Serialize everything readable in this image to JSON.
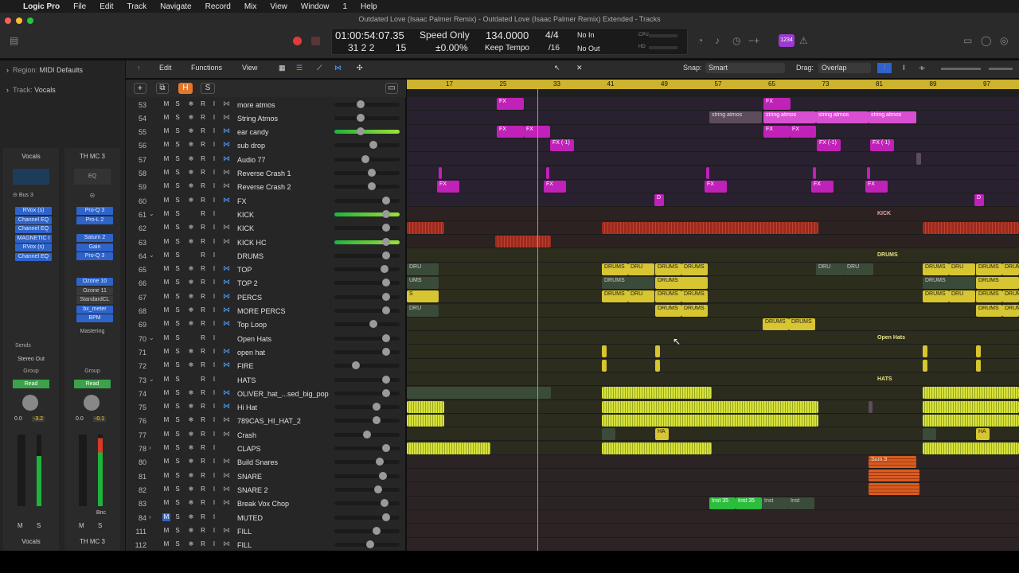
{
  "menu": {
    "apple": "",
    "app": "Logic Pro",
    "items": [
      "File",
      "Edit",
      "Track",
      "Navigate",
      "Record",
      "Mix",
      "View",
      "Window",
      "1",
      "Help"
    ]
  },
  "window": {
    "title": "Outdated Love (Isaac Palmer Remix) - Outdated Love (Isaac Palmer Remix) Extended - Tracks"
  },
  "lcd": {
    "time": "01:00:54:07.35",
    "bars": "31  2  2",
    "ticks": "15",
    "mode": "Speed Only",
    "speed": "±0.00%",
    "tempo": "134.0000",
    "tempo_mode": "Keep Tempo",
    "sig": "4/4",
    "div": "/16",
    "in": "No In",
    "out": "No Out",
    "cpu": "CPU",
    "hd": "HD"
  },
  "toolbar_badge": "1234",
  "inspector": {
    "region": "Region:",
    "region_val": "MIDI Defaults",
    "track": "Track:",
    "track_val": "Vocals"
  },
  "strip1": {
    "name": "Vocals",
    "bus": "Bus 3",
    "plugins": [
      "RVox (s)",
      "Channel EQ",
      "Channel EQ",
      "MAGNETIC I",
      "RVox (s)",
      "Channel EQ"
    ],
    "sends": "Sends",
    "output": "Stereo Out",
    "group": "Group",
    "auto": "Read",
    "pan": "0.0",
    "peak": "-3.2",
    "m": "M",
    "s": "S",
    "label": "Vocals"
  },
  "strip2": {
    "name": "TH MC 3",
    "eq": "EQ",
    "plugins": [
      "Pro-Q 3",
      "Pro-L 2"
    ],
    "plugins2": [
      "Saturn 2",
      "Gain",
      "Pro-Q 3"
    ],
    "plugins3": [
      "Ozone 10",
      "Ozone 11",
      "StandardCL",
      "bx_meter",
      "BPM"
    ],
    "mastering": "Mastering",
    "group": "Group",
    "auto": "Read",
    "pan": "0.0",
    "peak": "-0.1",
    "bnc": "Bnc",
    "m": "M",
    "s": "S",
    "label": "TH MC 3"
  },
  "ctrl": {
    "edit": "Edit",
    "functions": "Functions",
    "view": "View",
    "snap_label": "Snap:",
    "snap": "Smart",
    "drag_label": "Drag:",
    "drag": "Overlap"
  },
  "hdr": {
    "add": "+",
    "h": "H",
    "s": "S"
  },
  "ruler": [
    "17",
    "25",
    "33",
    "41",
    "49",
    "57",
    "65",
    "73",
    "81",
    "89",
    "97"
  ],
  "tracks": [
    {
      "n": "53",
      "name": "more atmos"
    },
    {
      "n": "54",
      "name": "String Atmos"
    },
    {
      "n": "55",
      "name": "ear candy"
    },
    {
      "n": "56",
      "name": "sub drop"
    },
    {
      "n": "57",
      "name": "Audio 77"
    },
    {
      "n": "58",
      "name": "Reverse Crash 1"
    },
    {
      "n": "59",
      "name": "Reverse Crash 2"
    },
    {
      "n": "60",
      "name": "FX"
    },
    {
      "n": "61",
      "name": "KICK"
    },
    {
      "n": "62",
      "name": "KICK"
    },
    {
      "n": "63",
      "name": "KICK HC"
    },
    {
      "n": "64",
      "name": "DRUMS"
    },
    {
      "n": "65",
      "name": "TOP"
    },
    {
      "n": "66",
      "name": "TOP 2"
    },
    {
      "n": "67",
      "name": "PERCS"
    },
    {
      "n": "68",
      "name": "MORE PERCS"
    },
    {
      "n": "69",
      "name": "Top Loop"
    },
    {
      "n": "70",
      "name": "Open Hats"
    },
    {
      "n": "71",
      "name": "open hat"
    },
    {
      "n": "72",
      "name": "FIRE"
    },
    {
      "n": "73",
      "name": "HATS"
    },
    {
      "n": "74",
      "name": "OLIVER_hat_...sed_big_pop"
    },
    {
      "n": "75",
      "name": "Hi Hat"
    },
    {
      "n": "76",
      "name": "789CAS_HI_HAT_2"
    },
    {
      "n": "77",
      "name": "Crash"
    },
    {
      "n": "78",
      "name": "CLAPS"
    },
    {
      "n": "80",
      "name": "Build Snares"
    },
    {
      "n": "81",
      "name": "SNARE"
    },
    {
      "n": "82",
      "name": "SNARE 2"
    },
    {
      "n": "83",
      "name": "Break Vox Chop"
    },
    {
      "n": "84",
      "name": "MUTED"
    },
    {
      "n": "111",
      "name": "FILL"
    },
    {
      "n": "112",
      "name": "FILL"
    }
  ],
  "btn": {
    "m": "M",
    "s": "S",
    "frz": "❄",
    "r": "R",
    "i": "I"
  },
  "regions": {
    "fx": "FX",
    "fxm1": "FX (-1)",
    "sa": "string atmos",
    "drums": "DRUMS",
    "dru": "DRU",
    "kick": "KICK",
    "drumsf": "DRUMS",
    "openhats": "Open Hats",
    "hats": "HATS",
    "sum9": "Sum 9",
    "inst35": "Inst 35",
    "inst": "Inst",
    "d": "D",
    "ha": "HA",
    "ums": "UMS",
    "u": "U",
    "s": "S"
  }
}
